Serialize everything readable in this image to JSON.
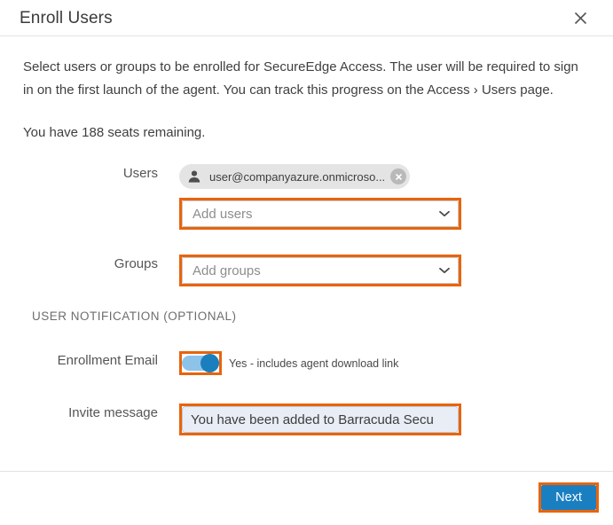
{
  "dialog": {
    "title": "Enroll Users",
    "close_icon": "close-icon",
    "intro": "Select users or groups to be enrolled for SecureEdge Access. The user will be required to sign in on the first launch of the agent. You can track this progress on the Access › Users page.",
    "seats_text": "You have 188 seats remaining.",
    "seats_count": 188
  },
  "form": {
    "users": {
      "label": "Users",
      "chips": [
        {
          "avatar_icon": "person-icon",
          "text": "user@companyazure.onmicroso...",
          "remove_icon": "circle-close-icon"
        }
      ],
      "select": {
        "placeholder": "Add users",
        "chevron_icon": "chevron-down-icon",
        "highlighted": true
      }
    },
    "groups": {
      "label": "Groups",
      "select": {
        "placeholder": "Add groups",
        "chevron_icon": "chevron-down-icon",
        "highlighted": true
      }
    },
    "section_title": "USER NOTIFICATION (OPTIONAL)",
    "enrollment_email": {
      "label": "Enrollment Email",
      "toggle_on": true,
      "caption": "Yes - includes agent download link",
      "highlighted": true
    },
    "invite_message": {
      "label": "Invite message",
      "value": "You have been added to Barracuda Secu",
      "placeholder": "Invite message",
      "highlighted": true
    }
  },
  "footer": {
    "next_label": "Next",
    "highlighted": true
  },
  "colors": {
    "highlight": "#e8640c",
    "primary_button": "#1a7fc1",
    "toggle_track": "#8dc3e8",
    "toggle_thumb": "#1b7fbd",
    "chip_background": "#e4e4e4",
    "input_focus_background": "#e8edf6"
  }
}
